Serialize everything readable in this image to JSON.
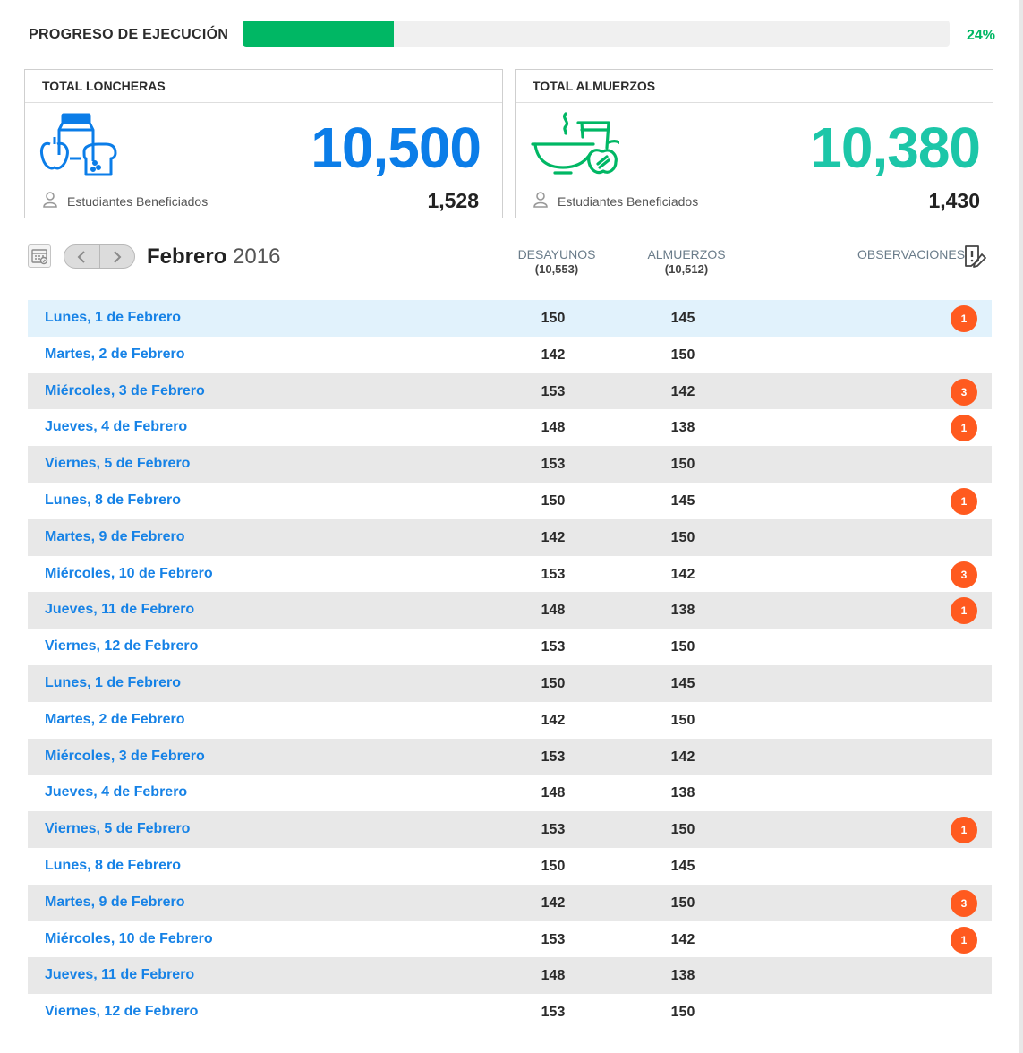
{
  "progress": {
    "label": "PROGRESO DE EJECUCIÓN",
    "percent_text": "24%",
    "value": 0.24
  },
  "cards": [
    {
      "title": "TOTAL LONCHERAS",
      "value": "10,500",
      "foot_label": "Estudiantes Beneficiados",
      "foot_value": "1,528",
      "color": "#0b7de8",
      "icon": "lunchbox-icon"
    },
    {
      "title": "TOTAL ALMUERZOS",
      "value": "10,380",
      "foot_label": "Estudiantes Beneficiados",
      "foot_value": "1,430",
      "color": "#1cc6a8",
      "icon": "meal-bowl-icon"
    }
  ],
  "calendar": {
    "month": "Febrero",
    "year": "2016"
  },
  "columns": {
    "desayunos": {
      "label": "DESAYUNOS",
      "total": "(10,553)"
    },
    "almuerzos": {
      "label": "ALMUERZOS",
      "total": "(10,512)"
    },
    "observaciones": {
      "label": "OBSERVACIONES"
    }
  },
  "rows": [
    {
      "day": "Lunes, 1 de Febrero",
      "desayunos": "150",
      "almuerzos": "145",
      "obs": "1"
    },
    {
      "day": "Martes, 2 de Febrero",
      "desayunos": "142",
      "almuerzos": "150",
      "obs": ""
    },
    {
      "day": "Miércoles, 3 de Febrero",
      "desayunos": "153",
      "almuerzos": "142",
      "obs": "3"
    },
    {
      "day": "Jueves, 4 de Febrero",
      "desayunos": "148",
      "almuerzos": "138",
      "obs": "1"
    },
    {
      "day": "Viernes, 5 de Febrero",
      "desayunos": "153",
      "almuerzos": "150",
      "obs": ""
    },
    {
      "day": "Lunes, 8 de Febrero",
      "desayunos": "150",
      "almuerzos": "145",
      "obs": "1"
    },
    {
      "day": "Martes, 9 de Febrero",
      "desayunos": "142",
      "almuerzos": "150",
      "obs": ""
    },
    {
      "day": "Miércoles, 10 de Febrero",
      "desayunos": "153",
      "almuerzos": "142",
      "obs": "3"
    },
    {
      "day": "Jueves, 11 de Febrero",
      "desayunos": "148",
      "almuerzos": "138",
      "obs": "1"
    },
    {
      "day": "Viernes, 12 de Febrero",
      "desayunos": "153",
      "almuerzos": "150",
      "obs": ""
    },
    {
      "day": "Lunes, 1 de Febrero",
      "desayunos": "150",
      "almuerzos": "145",
      "obs": ""
    },
    {
      "day": "Martes, 2 de Febrero",
      "desayunos": "142",
      "almuerzos": "150",
      "obs": ""
    },
    {
      "day": "Miércoles, 3 de Febrero",
      "desayunos": "153",
      "almuerzos": "142",
      "obs": ""
    },
    {
      "day": "Jueves, 4 de Febrero",
      "desayunos": "148",
      "almuerzos": "138",
      "obs": ""
    },
    {
      "day": "Viernes, 5 de Febrero",
      "desayunos": "153",
      "almuerzos": "150",
      "obs": "1"
    },
    {
      "day": "Lunes, 8 de Febrero",
      "desayunos": "150",
      "almuerzos": "145",
      "obs": ""
    },
    {
      "day": "Martes, 9 de Febrero",
      "desayunos": "142",
      "almuerzos": "150",
      "obs": "3"
    },
    {
      "day": "Miércoles, 10 de Febrero",
      "desayunos": "153",
      "almuerzos": "142",
      "obs": "1"
    },
    {
      "day": "Jueves, 11 de Febrero",
      "desayunos": "148",
      "almuerzos": "138",
      "obs": ""
    },
    {
      "day": "Viernes, 12 de Febrero",
      "desayunos": "153",
      "almuerzos": "150",
      "obs": ""
    }
  ]
}
